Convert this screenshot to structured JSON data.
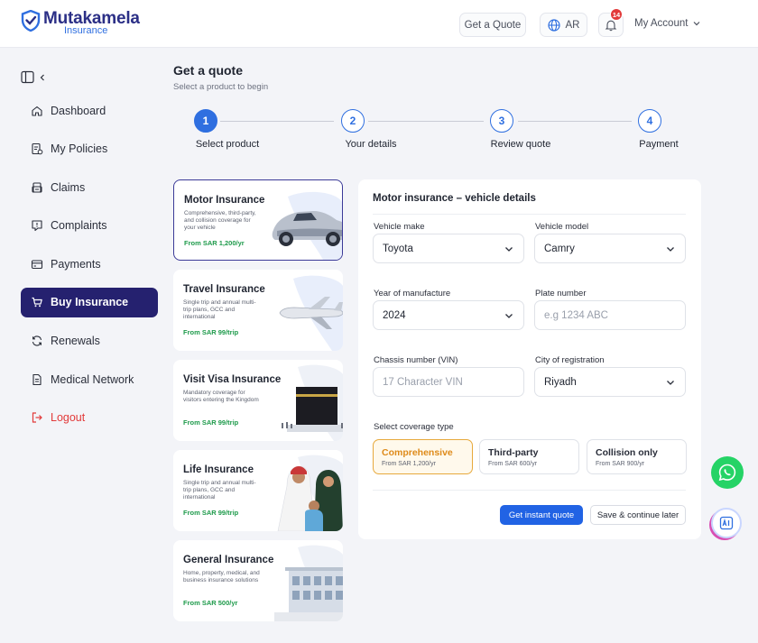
{
  "header": {
    "brand_name": "Mutakamela",
    "brand_sub": "Insurance",
    "get_quote": "Get a Quote",
    "language": "AR",
    "notif_count": "14",
    "account": "My Account"
  },
  "sidebar": {
    "items": [
      {
        "label": "Dashboard",
        "icon": "home-icon"
      },
      {
        "label": "My Policies",
        "icon": "policy-icon"
      },
      {
        "label": "Claims",
        "icon": "claims-icon"
      },
      {
        "label": "Complaints",
        "icon": "complaint-icon"
      },
      {
        "label": "Payments",
        "icon": "payment-icon"
      },
      {
        "label": "Buy Insurance",
        "icon": "cart-icon"
      },
      {
        "label": "Renewals",
        "icon": "refresh-icon"
      },
      {
        "label": "Medical Network",
        "icon": "document-icon"
      }
    ],
    "logout": "Logout"
  },
  "page": {
    "title": "Get a quote",
    "subtitle": "Select a product to begin"
  },
  "stepper": {
    "steps": [
      {
        "num": "1",
        "label": "Select product"
      },
      {
        "num": "2",
        "label": "Your details"
      },
      {
        "num": "3",
        "label": "Review quote"
      },
      {
        "num": "4",
        "label": "Payment"
      }
    ]
  },
  "products": [
    {
      "title": "Motor Insurance",
      "desc": "Comprehensive, third-party, and collision coverage for your vehicle",
      "price": "From SAR 1,200/yr"
    },
    {
      "title": "Travel Insurance",
      "desc": "Single trip and annual multi-trip plans, GCC and international",
      "price": "From SAR 99/trip"
    },
    {
      "title": "Visit Visa Insurance",
      "desc": "Mandatory coverage for visitors entering the Kingdom",
      "price": "From SAR 99/trip"
    },
    {
      "title": "Life Insurance",
      "desc": "Single trip and annual multi-trip plans, GCC and international",
      "price": "From SAR 99/trip"
    },
    {
      "title": "General Insurance",
      "desc": "Home, property, medical, and business insurance solutions",
      "price": "From SAR 500/yr"
    }
  ],
  "form": {
    "title": "Motor insurance – vehicle details",
    "make_label": "Vehicle make",
    "make_value": "Toyota",
    "model_label": "Vehicle model",
    "model_value": "Camry",
    "year_label": "Year of manufacture",
    "year_value": "2024",
    "plate_label": "Plate number",
    "plate_placeholder": "e.g 1234 ABC",
    "vin_label": "Chassis number (VIN)",
    "vin_placeholder": "17 Character VIN",
    "city_label": "City of registration",
    "city_value": "Riyadh",
    "coverage_label": "Select coverage type",
    "coverage": [
      {
        "name": "Comprehensive",
        "price": "From SAR 1,200/yr"
      },
      {
        "name": "Third-party",
        "price": "From SAR 600/yr"
      },
      {
        "name": "Collision only",
        "price": "From SAR 900/yr"
      }
    ],
    "primary_btn": "Get instant quote",
    "secondary_btn": "Save & continue later"
  },
  "colors": {
    "brand": "#2b2f86",
    "accent_blue": "#2163e4",
    "active_nav": "#25216f",
    "price_green": "#1d9a4a",
    "logout_red": "#e23a3a",
    "selected_coverage": "#de8a19"
  }
}
